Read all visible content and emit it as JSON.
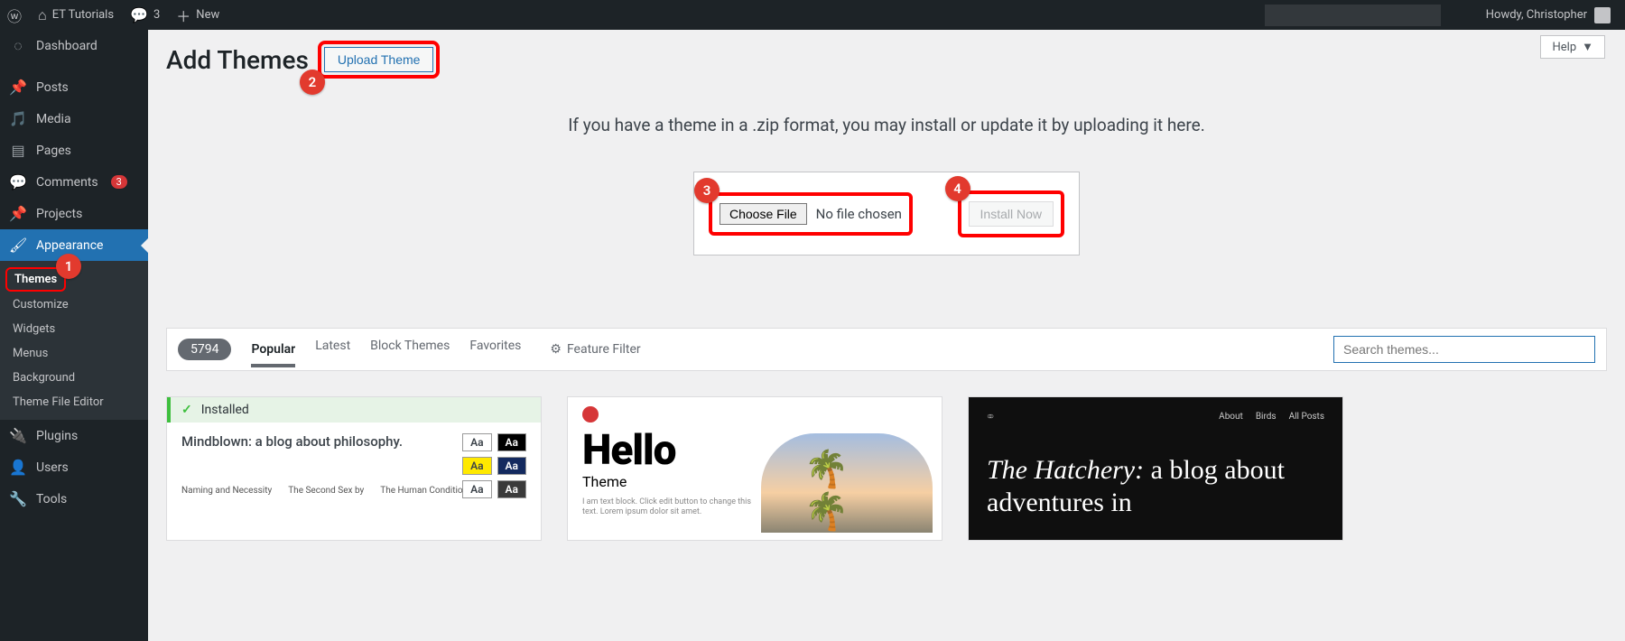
{
  "adminbar": {
    "site_name": "ET Tutorials",
    "comment_count": "3",
    "new_label": "New",
    "greeting": "Howdy, Christopher"
  },
  "sidebar": {
    "dashboard": "Dashboard",
    "posts": "Posts",
    "media": "Media",
    "pages": "Pages",
    "comments": "Comments",
    "comments_badge": "3",
    "projects": "Projects",
    "appearance": "Appearance",
    "appearance_sub": {
      "themes": "Themes",
      "customize": "Customize",
      "widgets": "Widgets",
      "menus": "Menus",
      "background": "Background",
      "theme_file_editor": "Theme File Editor"
    },
    "plugins": "Plugins",
    "users": "Users",
    "tools": "Tools"
  },
  "page": {
    "help": "Help",
    "title": "Add Themes",
    "upload_button": "Upload Theme",
    "instruction": "If you have a theme in a .zip format, you may install or update it by uploading it here.",
    "choose_file": "Choose File",
    "no_file": "No file chosen",
    "install_now": "Install Now"
  },
  "filter": {
    "count": "5794",
    "popular": "Popular",
    "latest": "Latest",
    "block_themes": "Block Themes",
    "favorites": "Favorites",
    "feature_filter": "Feature Filter",
    "search_placeholder": "Search themes..."
  },
  "themes": {
    "installed_label": "Installed",
    "tt_headline": "Mindblown: a blog about philosophy.",
    "tt_posts": [
      "Naming and Necessity",
      "The Second Sex by",
      "The Human Condition"
    ],
    "swatch_text": "Aa",
    "hello_title": "Hello",
    "hello_sub": "Theme",
    "hello_lorem": "I am text block. Click edit button to change this text. Lorem ipsum dolor sit amet.",
    "dark_nav": {
      "about": "About",
      "birds": "Birds",
      "allposts": "All Posts"
    },
    "dark_title_ital": "The Hatchery:",
    "dark_title_rest": " a blog about adventures in"
  },
  "annotations": {
    "a1": "1",
    "a2": "2",
    "a3": "3",
    "a4": "4"
  }
}
